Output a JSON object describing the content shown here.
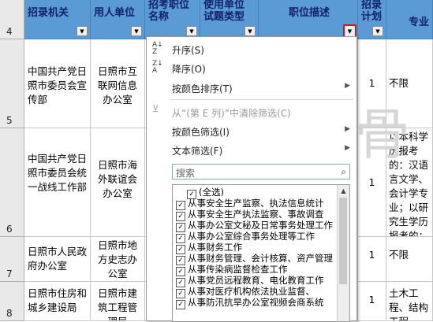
{
  "rows": [
    "4",
    "5",
    "6",
    "7",
    "8"
  ],
  "headers": [
    {
      "l1": "招录机关",
      "l2": ""
    },
    {
      "l1": "用人单位",
      "l2": ""
    },
    {
      "l1": "招考职位",
      "l2": "名称"
    },
    {
      "l1": "使用单位",
      "l2": "试题类型"
    },
    {
      "l1": "职位描述",
      "l2": ""
    },
    {
      "l1": "招录",
      "l2": "计划"
    },
    {
      "l1": "专业",
      "l2": ""
    }
  ],
  "data_rows": [
    {
      "org": "中国共产党日照市委员会宣传部",
      "unit": "日照市互联网信息办公室",
      "plan": "1",
      "major": "不限"
    },
    {
      "org": "中国共产党日照市委员会统一战线工作部",
      "unit": "日照市海外联谊会办公室",
      "plan": "1",
      "major": "以本科学历报考的：汉语言文学、会计学专业；以研究生学历报考的：汉语言文字学、新闻学、专业及其相近专业"
    },
    {
      "org": "日照市人民政府办公室",
      "unit": "日照市地方史志办公室",
      "plan": "1",
      "major": "不限"
    },
    {
      "org": "日照市住房和城乡建设局",
      "unit": "日照市建筑工程管理局",
      "plan": "1",
      "major": "土木工程、结构工程"
    }
  ],
  "ghost_char": "骨",
  "menu": {
    "sort_asc": "升序(S)",
    "sort_desc": "降序(O)",
    "sort_by_color": "按颜色排序(T)",
    "clear_filter": "从“(第 E 列)”中清除筛选(C)",
    "filter_by_color": "按颜色筛选(I)",
    "text_filter": "文本筛选(F)",
    "search_placeholder": "搜索",
    "items": [
      "(全选)",
      "从事安全生产监察、执法信息统计",
      "从事安全生产执法监察、事故调查",
      "从事办公室文秘及日常事务处理工作",
      "从事办公室综合事务处理等工作",
      "从事财务工作",
      "从事财务管理、会计核算、资产管理",
      "从事传染病监督检查工作",
      "从事党员远程教育、电化教育工作",
      "从事对医疗机构依法执业监督、",
      "从事防汛抗旱办公室视频会商系统"
    ]
  }
}
